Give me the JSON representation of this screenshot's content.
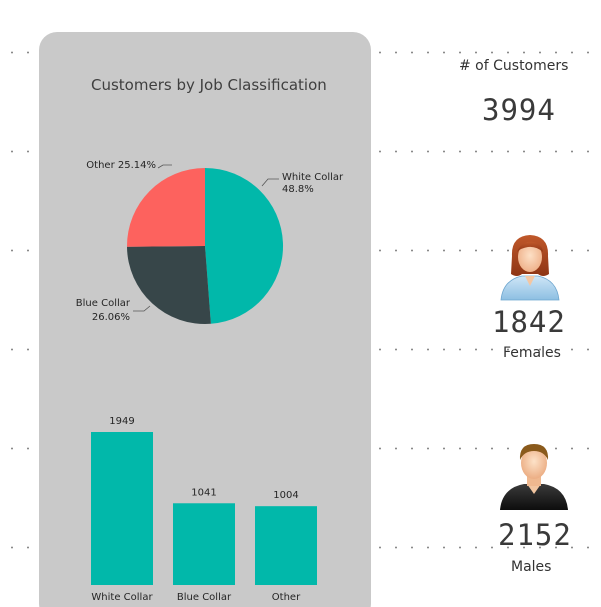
{
  "pie_card": {
    "title": "Customers by Job Classification"
  },
  "kpis": {
    "customers_label": "#  of Customers",
    "customers_value": "3994",
    "females_value": "1842",
    "females_label": "Females",
    "males_value": "2152",
    "males_label": "Males"
  },
  "chart_data": [
    {
      "type": "pie",
      "title": "Customers by Job Classification",
      "slices": [
        {
          "label": "White Collar",
          "value": 48.8,
          "display": "48.8%",
          "color": "#01b8aa"
        },
        {
          "label": "Blue Collar",
          "value": 26.06,
          "display": "26.06%",
          "color": "#374649"
        },
        {
          "label": "Other",
          "value": 25.14,
          "display": "25.14%",
          "color": "#fd625e"
        }
      ]
    },
    {
      "type": "bar",
      "categories": [
        "White Collar",
        "Blue Collar",
        "Other"
      ],
      "values": [
        1949,
        1041,
        1004
      ],
      "color": "#01b8aa"
    }
  ],
  "icons": {
    "female": "female-user-icon",
    "male": "male-user-icon"
  }
}
